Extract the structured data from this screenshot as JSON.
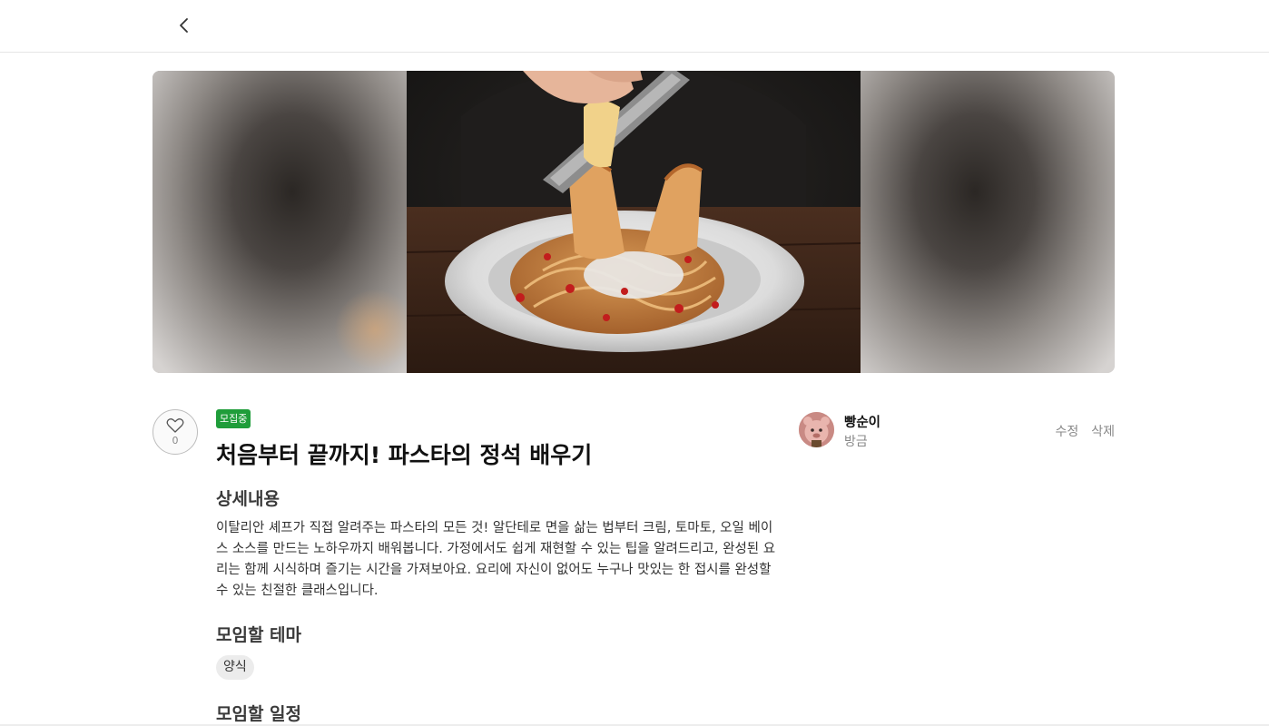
{
  "header": {
    "back_icon": "chevron-left-icon"
  },
  "post": {
    "status_badge": "모집중",
    "title": "처음부터 끝까지! 파스타의 정석 배우기",
    "like_count": "0",
    "like_icon": "heart-icon",
    "sections": {
      "detail_heading": "상세내용",
      "detail_text": "이탈리안 셰프가 직접 알려주는 파스타의 모든 것! 알단테로 면을 삶는 법부터 크림, 토마토, 오일 베이스 소스를 만드는 노하우까지 배워봅니다. 가정에서도 쉽게 재현할 수 있는 팁을 알려드리고, 완성된 요리는 함께 시식하며 즐기는 시간을 가져보아요. 요리에 자신이 없어도 누구나 맛있는 한 접시를 완성할 수 있는 친절한 클래스입니다.",
      "theme_heading": "모임할 테마",
      "theme_tag": "양식",
      "schedule_heading": "모임할 일정"
    }
  },
  "author": {
    "name": "빵순이",
    "time": "방금"
  },
  "actions": {
    "edit_label": "수정",
    "delete_label": "삭제"
  },
  "colors": {
    "badge_green": "#1f9d3a",
    "muted_text": "#888888",
    "divider": "#e6e6e6"
  }
}
